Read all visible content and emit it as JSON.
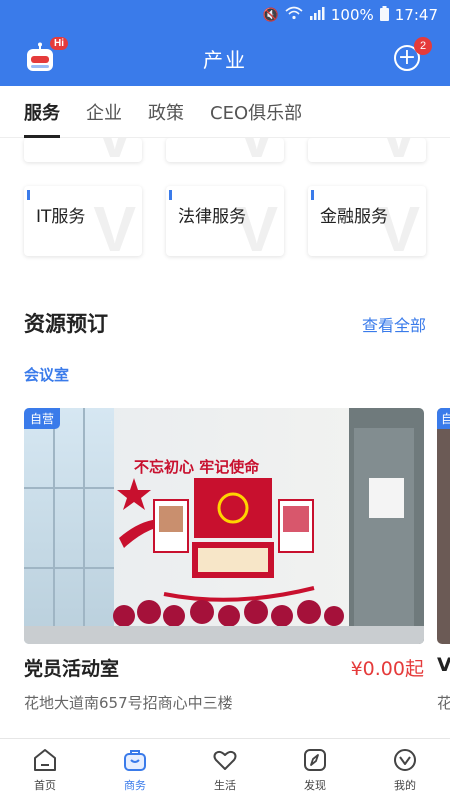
{
  "status_bar": {
    "battery": "100%",
    "time": "17:47"
  },
  "header": {
    "title": "产业",
    "robot_badge": "Hi",
    "add_badge": "2"
  },
  "tabs": [
    {
      "label": "服务",
      "active": true
    },
    {
      "label": "企业",
      "active": false
    },
    {
      "label": "政策",
      "active": false
    },
    {
      "label": "CEO俱乐部",
      "active": false
    }
  ],
  "services": {
    "items": [
      {
        "label": "IT服务"
      },
      {
        "label": "法律服务"
      },
      {
        "label": "金融服务"
      }
    ]
  },
  "resources": {
    "title": "资源预订",
    "view_all": "查看全部",
    "category": "会议室",
    "cards": [
      {
        "badge": "自营",
        "name": "党员活动室",
        "price": "¥0.00起",
        "address": "花地大道南657号招商心中三楼",
        "wall_slogan": "不忘初心 牢记使命"
      },
      {
        "badge": "自",
        "name": "V",
        "address": "花"
      }
    ]
  },
  "bottom_nav": [
    {
      "label": "首页",
      "icon": "home-icon",
      "active": false
    },
    {
      "label": "商务",
      "icon": "briefcase-icon",
      "active": true
    },
    {
      "label": "生活",
      "icon": "heart-icon",
      "active": false
    },
    {
      "label": "发现",
      "icon": "compass-icon",
      "active": false
    },
    {
      "label": "我的",
      "icon": "profile-icon",
      "active": false
    }
  ],
  "colors": {
    "brand": "#3a7bea",
    "price": "#e53b3b"
  }
}
